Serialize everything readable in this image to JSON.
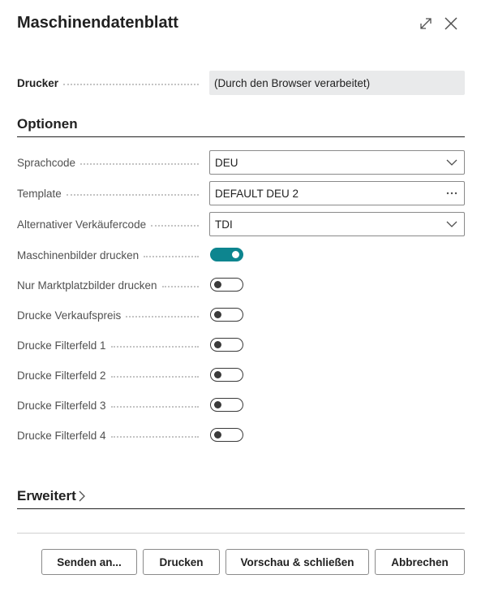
{
  "dialog": {
    "title": "Maschinendatenblatt"
  },
  "printer": {
    "label": "Drucker",
    "value": "(Durch den Browser verarbeitet)"
  },
  "options": {
    "heading": "Optionen",
    "language": {
      "label": "Sprachcode",
      "value": "DEU"
    },
    "template": {
      "label": "Template",
      "value": "DEFAULT DEU 2"
    },
    "salesperson": {
      "label": "Alternativer Verkäufercode",
      "value": "TDI"
    },
    "toggles": [
      {
        "label": "Maschinenbilder drucken",
        "on": true
      },
      {
        "label": "Nur Marktplatzbilder drucken",
        "on": false
      },
      {
        "label": "Drucke Verkaufspreis",
        "on": false
      },
      {
        "label": "Drucke Filterfeld 1",
        "on": false
      },
      {
        "label": "Drucke Filterfeld 2",
        "on": false
      },
      {
        "label": "Drucke Filterfeld 3",
        "on": false
      },
      {
        "label": "Drucke Filterfeld 4",
        "on": false
      }
    ]
  },
  "advanced": {
    "heading": "Erweitert"
  },
  "buttons": {
    "send": "Senden an...",
    "print": "Drucken",
    "preview": "Vorschau & schließen",
    "cancel": "Abbrechen"
  },
  "colors": {
    "toggle_on": "#0d858f",
    "readonly_bg": "#e9eaeb"
  }
}
